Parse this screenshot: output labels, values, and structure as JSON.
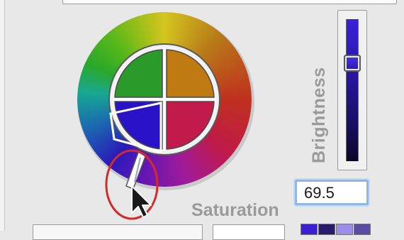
{
  "brightness": {
    "label": "Brightness",
    "level": 0.72
  },
  "saturation": {
    "label": "Saturation",
    "value": "69.5"
  },
  "wheel": {
    "selected_color": "#2a12c8",
    "quadrant_colors": [
      "#c07a12",
      "#c21a4a",
      "#2a12c8",
      "#2a9a2a"
    ]
  },
  "swatches": {
    "colors": [
      "#3a1fd0",
      "#2a1a6a",
      "#9a8ce8",
      "#5a4ca0"
    ]
  },
  "annotation": {
    "color": "#d42a2a"
  }
}
